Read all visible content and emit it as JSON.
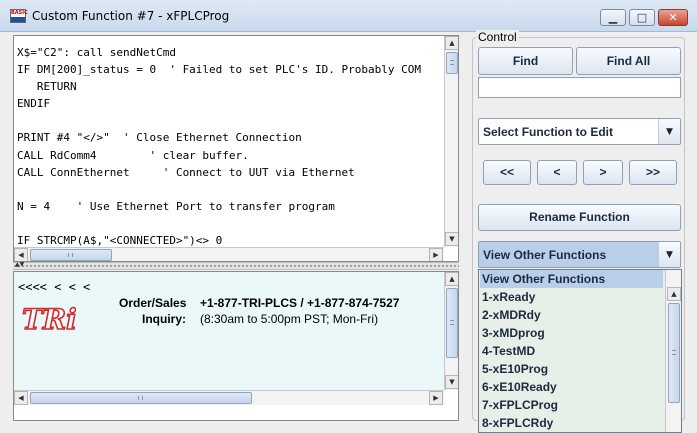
{
  "window": {
    "title": "Custom Function #7 - xFPLCProg",
    "icon": "basic-app-icon",
    "icon_text": "BASIC",
    "buttons": {
      "minimize": "minimize-icon",
      "maximize": "maximize-icon",
      "close": "close-icon"
    }
  },
  "editor": {
    "lines": [
      "X$=\"C2\": call sendNetCmd",
      "IF DM[200]_status = 0  ' Failed to set PLC's ID. Probably COM",
      "   RETURN",
      "ENDIF",
      "",
      "PRINT #4 \"</>\"  ' Close Ethernet Connection",
      "CALL RdComm4        ' clear buffer.",
      "CALL ConnEthernet     ' Connect to UUT via Ethernet",
      "",
      "N = 4    ' Use Ethernet Port to transfer program",
      "",
      "IF STRCMP(A$,\"<CONNECTED>\")<> 0"
    ]
  },
  "info": {
    "nav_arrows": "<<<< < < <",
    "logo": "TRi",
    "order_label": "Order/Sales",
    "order_value": "+1-877-TRI-PLCS  /  +1-877-874-7527",
    "inquiry_label": "Inquiry:",
    "inquiry_value": "(8:30am to 5:00pm PST; Mon-Fri)"
  },
  "control": {
    "label": "Control",
    "find": "Find",
    "find_all": "Find All",
    "search_value": "",
    "select_function": "Select Function to Edit",
    "nav": {
      "first": "<<",
      "prev": "<",
      "next": ">",
      "last": ">>"
    },
    "rename": "Rename Function",
    "view_other": "View Other Functions",
    "dropdown_items": [
      "View Other Functions",
      "1-xReady",
      "2-xMDRdy",
      "3-xMDprog",
      "4-TestMD",
      "5-xE10Prog",
      "6-xE10Ready",
      "7-xFPLCProg",
      "8-xFPLCRdy"
    ]
  }
}
